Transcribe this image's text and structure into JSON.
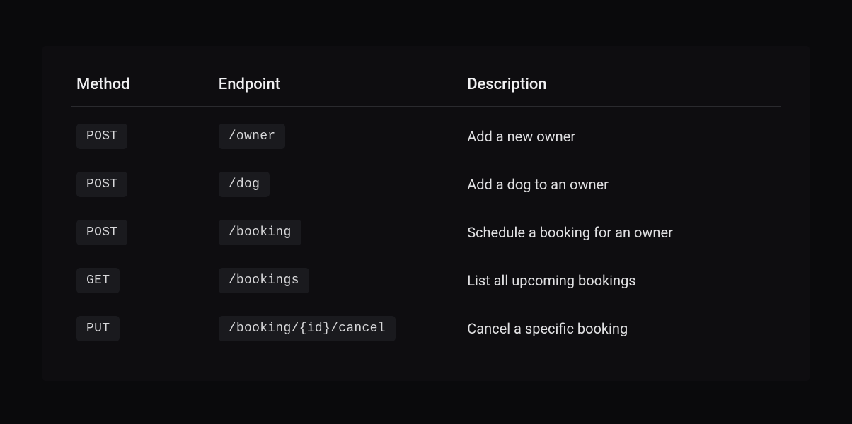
{
  "table": {
    "headers": {
      "method": "Method",
      "endpoint": "Endpoint",
      "description": "Description"
    },
    "rows": [
      {
        "method": "POST",
        "endpoint": "/owner",
        "description": "Add a new owner"
      },
      {
        "method": "POST",
        "endpoint": "/dog",
        "description": "Add a dog to an owner"
      },
      {
        "method": "POST",
        "endpoint": "/booking",
        "description": "Schedule a booking for an owner"
      },
      {
        "method": "GET",
        "endpoint": "/bookings",
        "description": "List all upcoming bookings"
      },
      {
        "method": "PUT",
        "endpoint": "/booking/{id}/cancel",
        "description": "Cancel a specific booking"
      }
    ]
  }
}
